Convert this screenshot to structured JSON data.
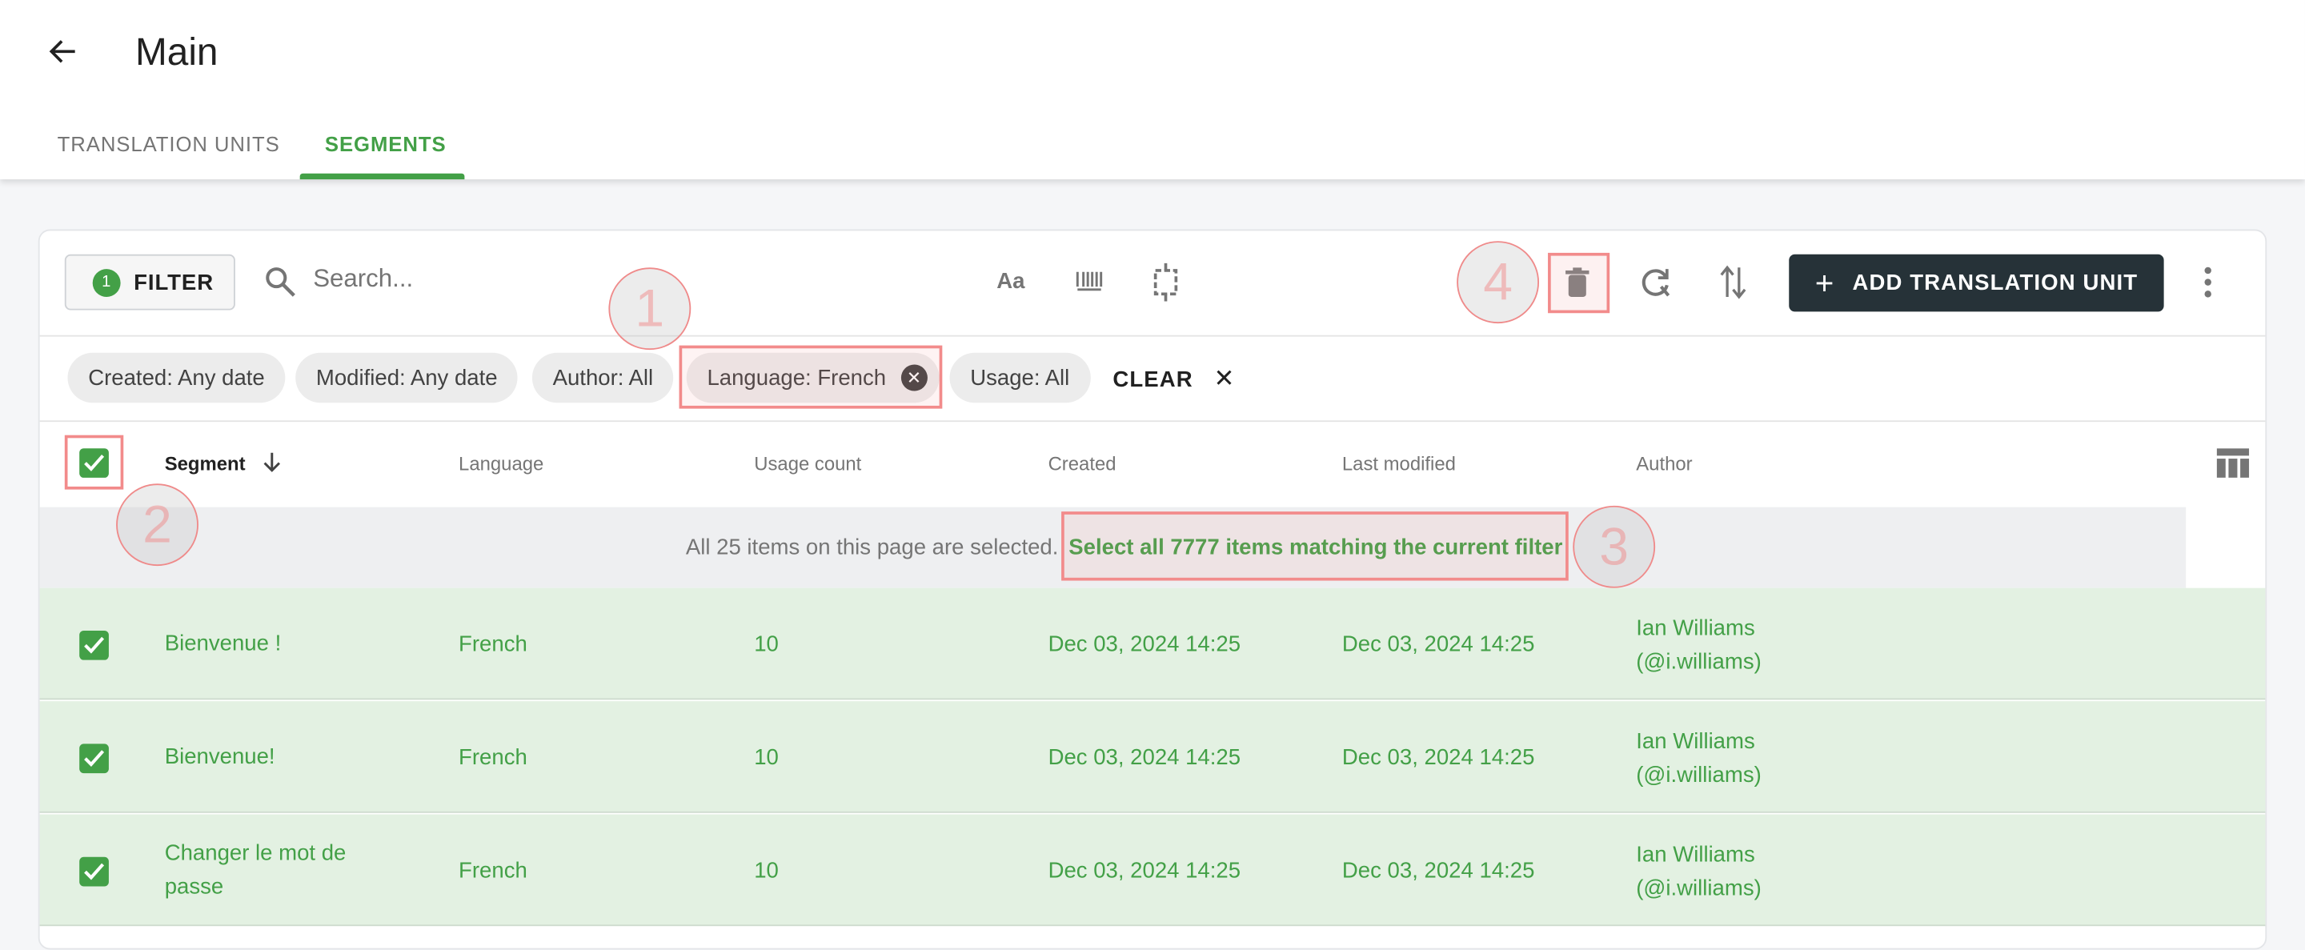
{
  "header": {
    "title": "Main",
    "back_icon": "arrow-left-icon"
  },
  "tabs": [
    {
      "label": "TRANSLATION UNITS",
      "active": false
    },
    {
      "label": "SEGMENTS",
      "active": true
    }
  ],
  "toolbar": {
    "filter_label": "FILTER",
    "filter_count": "1",
    "search_placeholder": "Search...",
    "case_label": "Aa",
    "add_label": "ADD TRANSLATION UNIT"
  },
  "chips": [
    {
      "label": "Created: Any date"
    },
    {
      "label": "Modified: Any date"
    },
    {
      "label": "Author: All"
    },
    {
      "label": "Language: French",
      "removable": true
    },
    {
      "label": "Usage: All"
    }
  ],
  "clear_label": "CLEAR",
  "columns": [
    "Segment",
    "Language",
    "Usage count",
    "Created",
    "Last modified",
    "Author"
  ],
  "banner": {
    "text": "All 25 items on this page are selected.",
    "link": "Select all 7777 items matching the current filter"
  },
  "rows": [
    {
      "segment": "Bienvenue !",
      "language": "French",
      "usage": "10",
      "created": "Dec 03, 2024 14:25",
      "modified": "Dec 03, 2024 14:25",
      "author": "Ian Williams",
      "handle": "(@i.williams)",
      "checked": true
    },
    {
      "segment": "Bienvenue!",
      "language": "French",
      "usage": "10",
      "created": "Dec 03, 2024 14:25",
      "modified": "Dec 03, 2024 14:25",
      "author": "Ian Williams",
      "handle": "(@i.williams)",
      "checked": true
    },
    {
      "segment": "Changer le mot de passe",
      "language": "French",
      "usage": "10",
      "created": "Dec 03, 2024 14:25",
      "modified": "Dec 03, 2024 14:25",
      "author": "Ian Williams",
      "handle": "(@i.williams)",
      "checked": true
    }
  ],
  "annotations": [
    "1",
    "2",
    "3",
    "4"
  ],
  "colors": {
    "accent": "#43a047",
    "selected_row": "#e3f1e2",
    "primary_button": "#263238",
    "annotation": "#f28b8b"
  }
}
